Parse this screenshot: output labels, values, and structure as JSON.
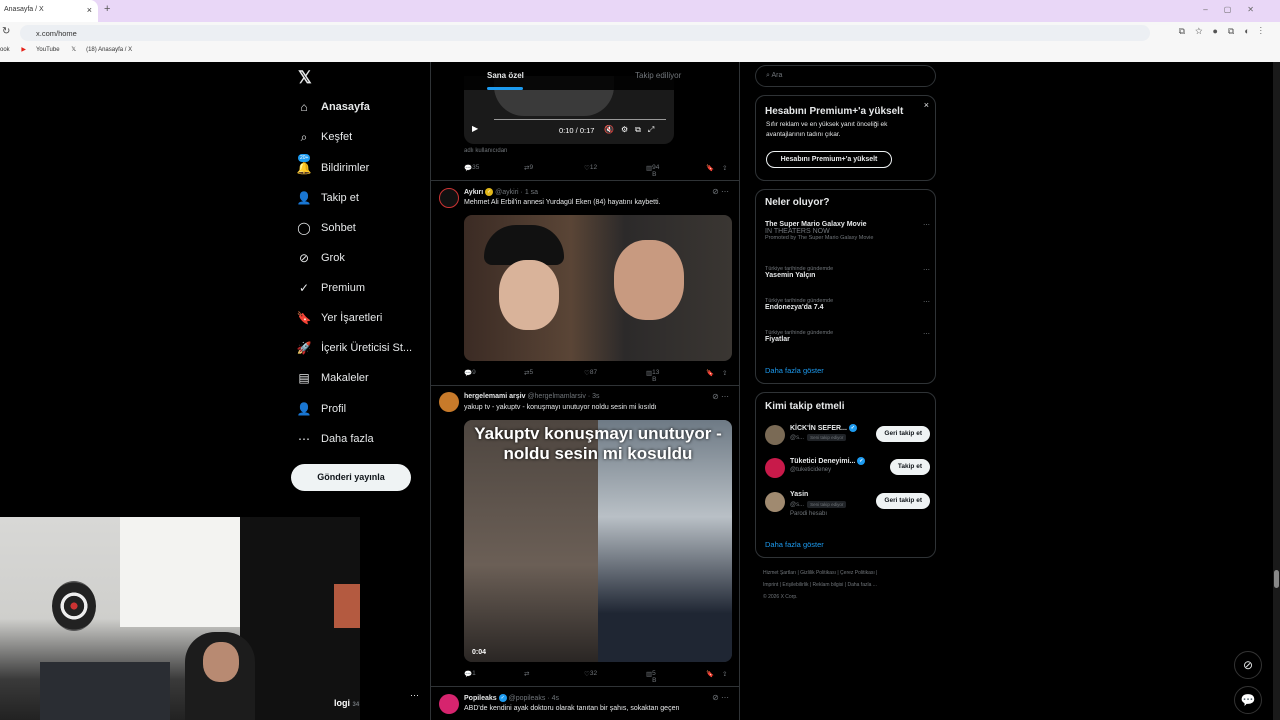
{
  "browser": {
    "tab_title": "Anasayfa / X",
    "url": "x.com/home",
    "bookmarks": [
      "ook",
      "YouTube",
      "(18) Anasayfa / X"
    ]
  },
  "nav": {
    "items": [
      {
        "label": "Anasayfa",
        "icon": "home-icon",
        "glyph": "⌂"
      },
      {
        "label": "Keşfet",
        "icon": "search-icon",
        "glyph": "⌕"
      },
      {
        "label": "Bildirimler",
        "icon": "bell-icon",
        "glyph": "🔔",
        "badge": "20+"
      },
      {
        "label": "Takip et",
        "icon": "person-plus-icon",
        "glyph": "👤"
      },
      {
        "label": "Sohbet",
        "icon": "chat-icon",
        "glyph": "◯"
      },
      {
        "label": "Grok",
        "icon": "grok-icon",
        "glyph": "⊘"
      },
      {
        "label": "Premium",
        "icon": "premium-icon",
        "glyph": "✓"
      },
      {
        "label": "Yer İşaretleri",
        "icon": "bookmark-icon",
        "glyph": "🔖"
      },
      {
        "label": "İçerik Üreticisi St...",
        "icon": "rocket-icon",
        "glyph": "🚀"
      },
      {
        "label": "Makaleler",
        "icon": "articles-icon",
        "glyph": "▤"
      },
      {
        "label": "Profil",
        "icon": "profile-icon",
        "glyph": "👤"
      },
      {
        "label": "Daha fazla",
        "icon": "more-circle-icon",
        "glyph": "⋯"
      }
    ],
    "post_button": "Gönderi yayınla"
  },
  "feed": {
    "tabs": [
      "Sana özel",
      "Takip ediliyor"
    ],
    "video1": {
      "time": "0:10 / 0:17",
      "caption": "adlı kullanıcıdan"
    },
    "post0_stats": {
      "replies": "35",
      "reposts": "9",
      "likes": "12",
      "views": "94 B"
    },
    "post1": {
      "name": "Aykırı",
      "handle": "@aykiri",
      "time": "1 sa",
      "text": "Mehmet Ali Erbil'in annesi Yurdagül Eken (84) hayatını kaybetti.",
      "stats": {
        "replies": "9",
        "reposts": "5",
        "likes": "87",
        "views": "13 B"
      }
    },
    "post2": {
      "name": "hergelemami arşiv",
      "handle": "@hergelmamlarsiv",
      "time": "3s",
      "text": "yakup tv - yakuptv - konuşmayı unutuyor noldu sesin mi kısıldı",
      "overlay": "Yakuptv konuşmayı unutuyor - noldu sesin mi kosuldu",
      "duration": "0:04",
      "stats": {
        "replies": "1",
        "reposts": "",
        "likes": "32",
        "views": "5 B"
      }
    },
    "post3": {
      "name": "Popileaks",
      "handle": "@popileaks",
      "time": "4s",
      "text": "ABD'de kendini ayak doktoru olarak tanıtan bir şahıs, sokaktan geçen"
    }
  },
  "sidebar": {
    "search_placeholder": "Ara",
    "premium": {
      "title": "Hesabını Premium+'a yükselt",
      "text": "Sıfır reklam ve en yüksek yanıt önceliği ek avantajlarının tadını çıkar.",
      "button": "Hesabını Premium+'a yükselt"
    },
    "trends": {
      "title": "Neler oluyor?",
      "items": [
        {
          "category": "",
          "name": "The Super Mario Galaxy Movie",
          "sub": "IN THEATERS NOW",
          "promo": "Promoted by The Super Mario Galaxy Movie"
        },
        {
          "category": "Türkiye tarihinde gündemde",
          "name": "Yasemin Yalçın",
          "sub": "",
          "promo": ""
        },
        {
          "category": "Türkiye tarihinde gündemde",
          "name": "Endonezya'da 7.4",
          "sub": "",
          "promo": ""
        },
        {
          "category": "Türkiye tarihinde gündemde",
          "name": "Fiyatlar",
          "sub": "",
          "promo": ""
        }
      ],
      "show_more": "Daha fazla göster"
    },
    "who_to_follow": {
      "title": "Kimi takip etmeli",
      "items": [
        {
          "name": "KİCK'İN SEFER...",
          "handle": "@s...",
          "follows_you": "Seni takip ediyor",
          "button": "Geri takip et",
          "extra": ""
        },
        {
          "name": "Tüketici Deneyimi...",
          "handle": "@tuketicideney",
          "follows_you": "",
          "button": "Takip et",
          "extra": ""
        },
        {
          "name": "Yasin",
          "handle": "@s...",
          "follows_you": "Seni takip ediyor",
          "button": "Geri takip et",
          "extra": "Parodi hesabı"
        }
      ],
      "show_more": "Daha fazla göster"
    },
    "footer": {
      "line1": "Hizmet Şartları | Gizlilik Politikası | Çerez Politikası |",
      "line2": "Imprint | Erişilebilirlik | Reklam bilgisi | Daha fazla ...",
      "line3": "© 2026 X Corp."
    }
  },
  "cam_overlay": {
    "user": "logi",
    "count": "34"
  },
  "colors": {
    "accent": "#1d9bf0",
    "bg": "#000000",
    "border": "#2f3336",
    "muted": "#71767b"
  }
}
